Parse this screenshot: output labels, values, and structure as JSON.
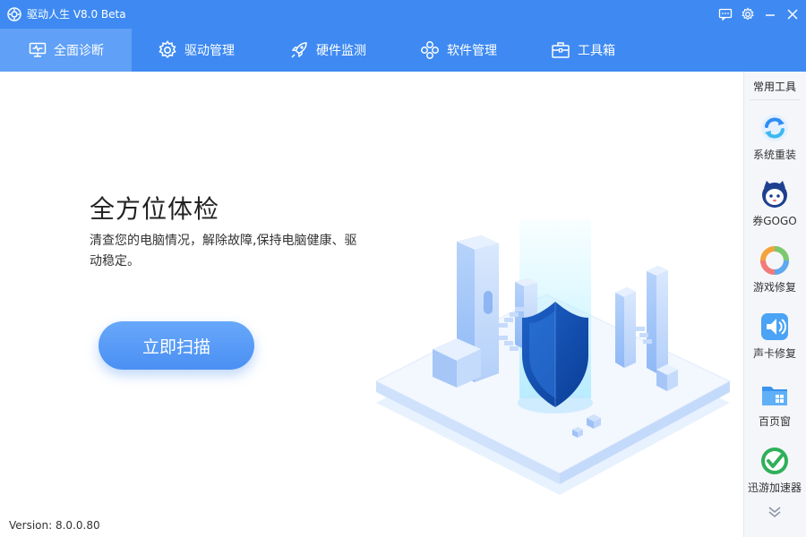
{
  "window": {
    "title": "驱动人生 V8.0 Beta",
    "accent_color": "#3e8af2",
    "controls": [
      "feedback-icon",
      "settings-icon",
      "minimize-icon",
      "close-icon"
    ]
  },
  "nav": {
    "tabs": [
      {
        "label": "全面诊断",
        "icon": "monitor-check-icon",
        "active": true
      },
      {
        "label": "驱动管理",
        "icon": "gear-icon",
        "active": false
      },
      {
        "label": "硬件监测",
        "icon": "rocket-icon",
        "active": false
      },
      {
        "label": "软件管理",
        "icon": "apps-icon",
        "active": false
      },
      {
        "label": "工具箱",
        "icon": "toolbox-icon",
        "active": false
      }
    ]
  },
  "main": {
    "headline": "全方位体检",
    "description": "清查您的电脑情况，解除故障,保持电脑健康、驱动稳定。",
    "scan_button": "立即扫描",
    "version": "Version:  8.0.0.80"
  },
  "tools": {
    "title": "常用工具",
    "items": [
      {
        "label": "系统重装",
        "icon": "reinstall-icon"
      },
      {
        "label": "券GOGO",
        "icon": "mascot-icon"
      },
      {
        "label": "游戏修复",
        "icon": "game-ring-icon"
      },
      {
        "label": "声卡修复",
        "icon": "speaker-icon"
      },
      {
        "label": "百页窗",
        "icon": "folder-icon"
      },
      {
        "label": "迅游加速器",
        "icon": "accelerator-icon"
      }
    ],
    "more_icon": "double-chevron-down-icon"
  }
}
